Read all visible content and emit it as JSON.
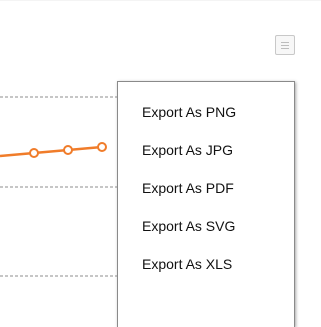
{
  "chart_data": {
    "type": "line",
    "title": "",
    "xlabel": "",
    "ylabel": "",
    "grid": true,
    "series": [
      {
        "color": "#f07c2a",
        "values": [
          0,
          0.15,
          0.3,
          0.45
        ]
      }
    ]
  },
  "export_menu": {
    "items": [
      {
        "label": "Export As PNG"
      },
      {
        "label": "Export As JPG"
      },
      {
        "label": "Export As PDF"
      },
      {
        "label": "Export As SVG"
      },
      {
        "label": "Export As XLS"
      }
    ]
  },
  "icons": {
    "menu_button": "hamburger-icon"
  },
  "colors": {
    "series_line": "#f07c2a",
    "gridline": "#8c8c8c",
    "menu_border": "#8a8a8a"
  }
}
